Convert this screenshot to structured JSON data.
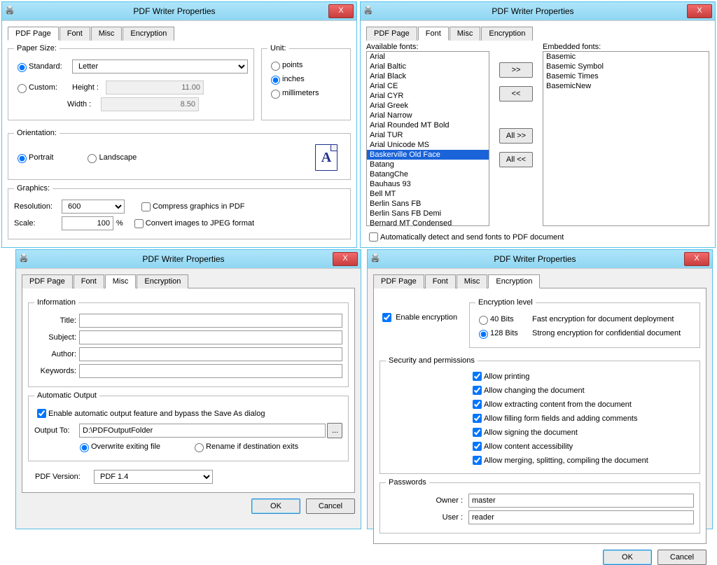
{
  "dialogs": [
    {
      "title": "PDF Writer Properties",
      "close": "X",
      "tabs": [
        "PDF Page",
        "Font",
        "Misc",
        "Encryption"
      ],
      "activeTab": 0,
      "paperSize": {
        "legend": "Paper Size:",
        "standardLabel": "Standard:",
        "standardValue": "Letter",
        "customLabel": "Custom:",
        "heightLabel": "Height :",
        "heightValue": "11.00",
        "widthLabel": "Width :",
        "widthValue": "8.50"
      },
      "unit": {
        "legend": "Unit:",
        "points": "points",
        "inches": "inches",
        "millimeters": "millimeters",
        "selected": "inches"
      },
      "orientation": {
        "legend": "Orientation:",
        "portrait": "Portrait",
        "landscape": "Landscape",
        "selected": "Portrait"
      },
      "graphics": {
        "legend": "Graphics:",
        "resolutionLabel": "Resolution:",
        "resolutionValue": "600",
        "scaleLabel": "Scale:",
        "scaleValue": "100",
        "scaleUnit": "%",
        "compressLabel": "Compress graphics in PDF",
        "convertLabel": "Convert images to JPEG format"
      }
    },
    {
      "title": "PDF Writer Properties",
      "close": "X",
      "tabs": [
        "PDF Page",
        "Font",
        "Misc",
        "Encryption"
      ],
      "activeTab": 1,
      "font": {
        "availableLabel": "Available fonts:",
        "embeddedLabel": "Embedded fonts:",
        "available": [
          "Arial",
          "Arial Baltic",
          "Arial Black",
          "Arial CE",
          "Arial CYR",
          "Arial Greek",
          "Arial Narrow",
          "Arial Rounded MT Bold",
          "Arial TUR",
          "Arial Unicode MS",
          "Baskerville Old Face",
          "Batang",
          "BatangChe",
          "Bauhaus 93",
          "Bell MT",
          "Berlin Sans FB",
          "Berlin Sans FB Demi",
          "Bernard MT Condensed"
        ],
        "selected": "Baskerville Old Face",
        "embedded": [
          "Basemic",
          "Basemic Symbol",
          "Basemic Times",
          "BasemicNew"
        ],
        "btnAdd": ">>",
        "btnRemove": "<<",
        "btnAllAdd": "All >>",
        "btnAllRemove": "All <<",
        "autoLabel": "Automatically detect and send fonts to PDF document"
      }
    },
    {
      "title": "PDF Writer Properties",
      "close": "X",
      "tabs": [
        "PDF Page",
        "Font",
        "Misc",
        "Encryption"
      ],
      "activeTab": 2,
      "info": {
        "legend": "Information",
        "titleLabel": "Title:",
        "subjectLabel": "Subject:",
        "authorLabel": "Author:",
        "keywordsLabel": "Keywords:"
      },
      "autoOutput": {
        "legend": "Automatic Output",
        "enableLabel": "Enable automatic output feature and bypass the Save As dialog",
        "outputToLabel": "Output To:",
        "outputToValue": "D:\\PDFOutputFolder",
        "browseBtn": "...",
        "overwriteLabel": "Overwrite exiting file",
        "renameLabel": "Rename if destination exits"
      },
      "pdfVersionLabel": "PDF Version:",
      "pdfVersionValue": "PDF 1.4",
      "okLabel": "OK",
      "cancelLabel": "Cancel"
    },
    {
      "title": "PDF Writer Properties",
      "close": "X",
      "tabs": [
        "PDF Page",
        "Font",
        "Misc",
        "Encryption"
      ],
      "activeTab": 3,
      "enableLabel": "Enable encryption",
      "encLevel": {
        "legend": "Encryption level",
        "opt40": "40 Bits",
        "opt128": "128 Bits",
        "desc40": "Fast encryption for document deployment",
        "desc128": "Strong encryption for confidential document",
        "selected": "128 Bits"
      },
      "security": {
        "legend": "Security and permissions",
        "items": [
          "Allow printing",
          "Allow changing the document",
          "Allow extracting content from the document",
          "Allow filling form fields and adding comments",
          "Allow signing the document",
          "Allow content accessibility",
          "Allow merging, splitting, compiling the document"
        ]
      },
      "passwords": {
        "legend": "Passwords",
        "ownerLabel": "Owner :",
        "ownerValue": "master",
        "userLabel": "User :",
        "userValue": "reader"
      },
      "okLabel": "OK",
      "cancelLabel": "Cancel"
    }
  ]
}
